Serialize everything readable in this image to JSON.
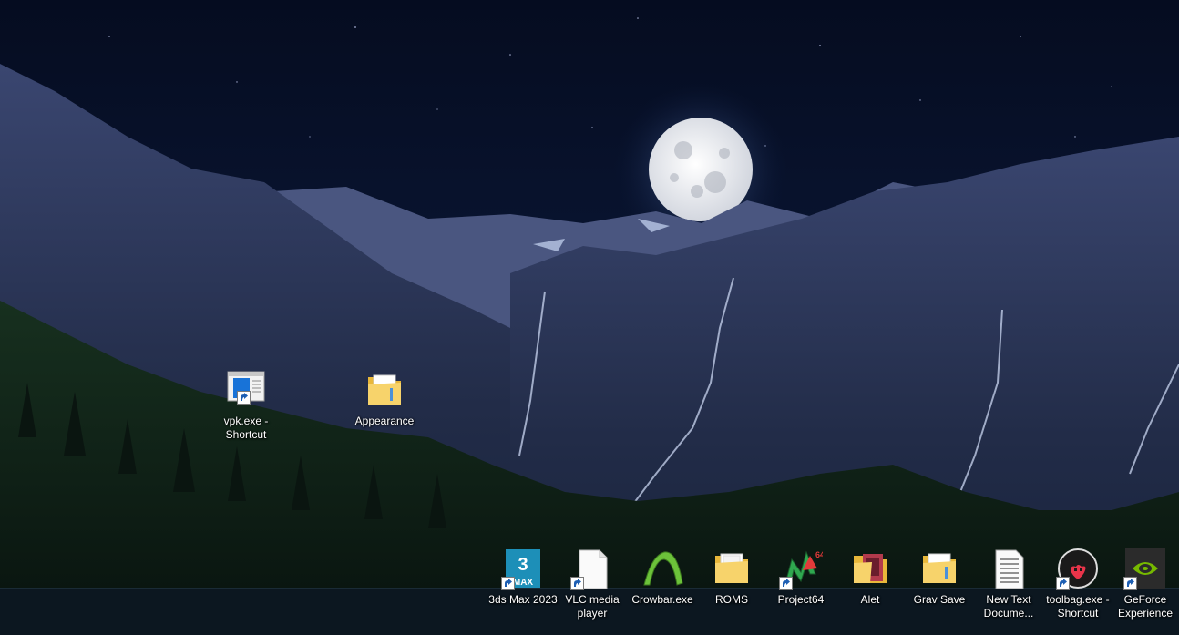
{
  "desktop": {
    "icons": [
      {
        "label": "vpk.exe - Shortcut",
        "icon": "vpk-app-icon"
      },
      {
        "label": "Appearance",
        "icon": "folder-icon"
      },
      {
        "label": "3ds Max 2023",
        "icon": "3ds-max-icon",
        "badge_number": "3",
        "badge_text": "MAX"
      },
      {
        "label": "VLC media player",
        "icon": "blank-file-icon"
      },
      {
        "label": "Crowbar.exe",
        "icon": "crowbar-icon"
      },
      {
        "label": "ROMS",
        "icon": "folder-icon"
      },
      {
        "label": "Project64",
        "icon": "project64-icon"
      },
      {
        "label": "Alet",
        "icon": "folder-icon"
      },
      {
        "label": "Grav Save",
        "icon": "folder-icon"
      },
      {
        "label": "New Text Docume...",
        "icon": "text-document-icon"
      },
      {
        "label": "toolbag.exe - Shortcut",
        "icon": "toolbag-icon"
      },
      {
        "label": "GeForce Experience",
        "icon": "nvidia-icon"
      }
    ]
  },
  "colors": {
    "sky": "#0a1633",
    "mountain": "#2a3556",
    "forest": "#0f1e18",
    "lake": "#0d1a22",
    "moon": "#eef0f4"
  }
}
